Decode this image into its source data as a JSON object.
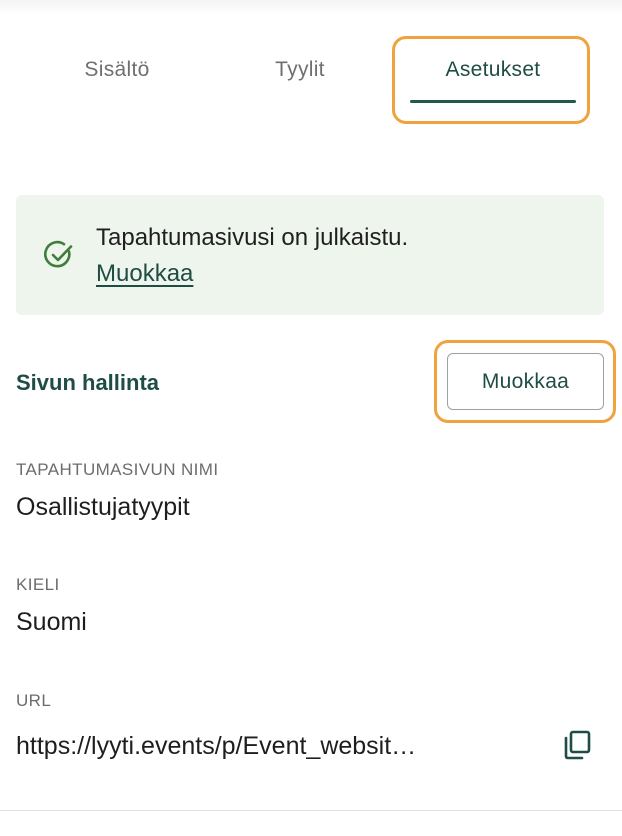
{
  "tabs": [
    {
      "label": "Sisältö"
    },
    {
      "label": "Tyylit"
    },
    {
      "label": "Asetukset"
    }
  ],
  "active_tab": "Asetukset",
  "banner": {
    "message": "Tapahtumasivusi on julkaistu.",
    "link_label": "Muokkaa",
    "icon": "check-circle-icon"
  },
  "page_management": {
    "title": "Sivun hallinta",
    "edit_label": "Muokkaa"
  },
  "fields": {
    "name": {
      "label": "TAPAHTUMASIVUN NIMI",
      "value": "Osallistujatyypit"
    },
    "language": {
      "label": "KIELI",
      "value": "Suomi"
    },
    "url": {
      "label": "URL",
      "value": "https://lyyti.events/p/Event_websit…",
      "icon": "copy-icon"
    }
  },
  "colors": {
    "accent": "#1f4d45",
    "focus": "#f0a33d",
    "banner_bg": "#eef5ec",
    "check": "#3f7d3a"
  }
}
